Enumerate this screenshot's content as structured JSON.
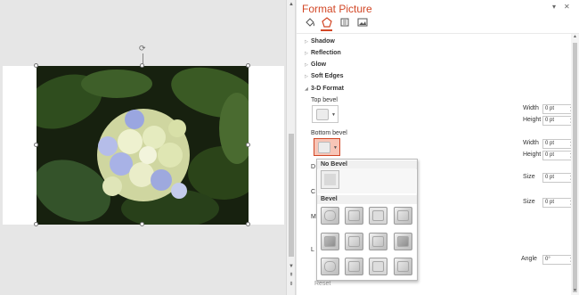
{
  "pane": {
    "title": "Format Picture",
    "collapse_glyph": "▾",
    "close_glyph": "✕",
    "tabs": [
      {
        "name": "fill-line",
        "icon": "paint-bucket-icon"
      },
      {
        "name": "effects",
        "icon": "pentagon-icon",
        "active": true
      },
      {
        "name": "size-properties",
        "icon": "size-layout-icon"
      },
      {
        "name": "picture",
        "icon": "picture-icon"
      }
    ],
    "sections": {
      "shadow": "Shadow",
      "reflection": "Reflection",
      "glow": "Glow",
      "soft_edges": "Soft Edges",
      "format_3d": "3-D Format"
    },
    "format_3d": {
      "top_bevel_label": "Top bevel",
      "bottom_bevel_label": "Bottom bevel",
      "width_label": "Width",
      "height_label": "Height",
      "size_label": "Size",
      "angle_label": "Angle",
      "top_width": "0 pt",
      "top_height": "0 pt",
      "bottom_width": "0 pt",
      "bottom_height": "0 pt",
      "depth_size": "0 pt",
      "contour_size": "0 pt",
      "angle": "0°",
      "partial_d": "D",
      "partial_c": "C",
      "partial_m": "M",
      "partial_l": "L",
      "reset": "Reset"
    }
  },
  "dropdown": {
    "no_bevel_header": "No Bevel",
    "bevel_header": "Bevel"
  },
  "slide": {
    "rotate_glyph": "⟳",
    "colors": {
      "accent": "#d24726",
      "leaf": "#2e4a1d",
      "flower": "#e8ecc0",
      "flower_blue": "#9aa6e0"
    }
  }
}
